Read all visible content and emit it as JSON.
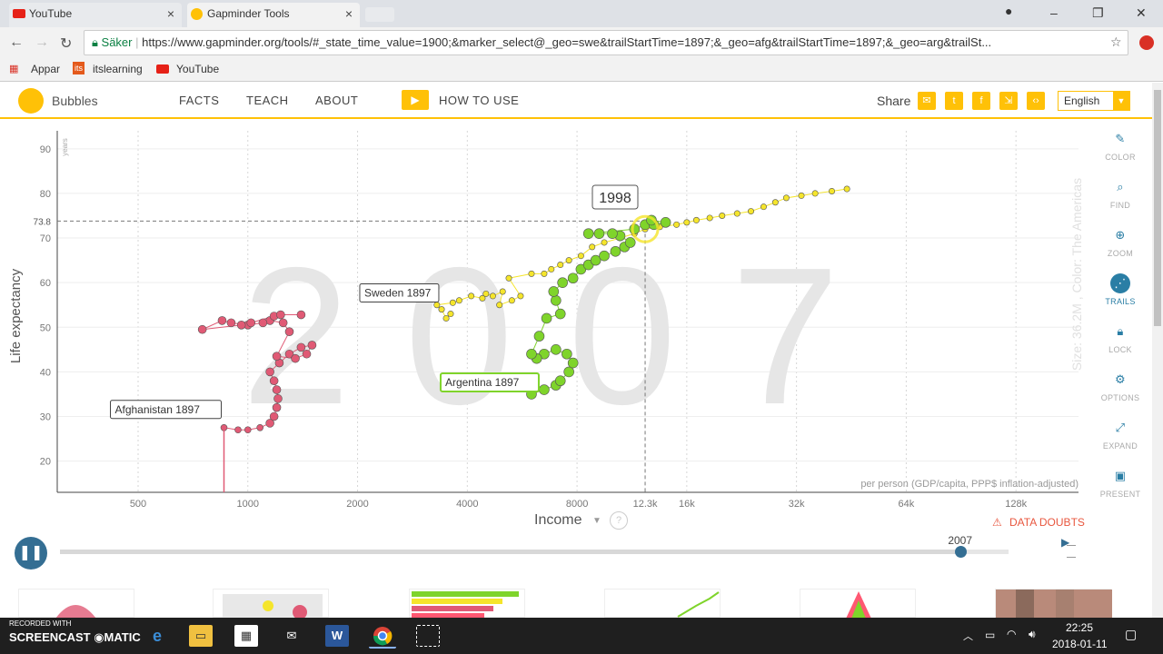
{
  "browser": {
    "tabs": [
      {
        "label": "YouTube",
        "close": "×"
      },
      {
        "label": "Gapminder Tools",
        "close": "×"
      }
    ],
    "security_label": "Säker",
    "url": "https://www.gapminder.org/tools/#_state_time_value=1900;&marker_select@_geo=swe&trailStartTime=1897;&_geo=afg&trailStartTime=1897;&_geo=arg&trailSt...",
    "bookmarks": [
      "Appar",
      "itslearning",
      "YouTube"
    ],
    "bookmark_badge": "its"
  },
  "header": {
    "app_name": "Bubbles",
    "nav": [
      "FACTS",
      "TEACH",
      "ABOUT"
    ],
    "how_to_use": "HOW TO USE",
    "share_label": "Share",
    "language": "English"
  },
  "chart_data": {
    "type": "scatter",
    "x_scale": "log",
    "xlim": [
      300,
      190000
    ],
    "ylim": [
      13,
      92
    ],
    "yticks": [
      20,
      30,
      40,
      50,
      60,
      70,
      80,
      90
    ],
    "xticks": [
      {
        "v": 500,
        "label": "500"
      },
      {
        "v": 1000,
        "label": "1000"
      },
      {
        "v": 2000,
        "label": "2000"
      },
      {
        "v": 4000,
        "label": "4000"
      },
      {
        "v": 8000,
        "label": "8000"
      },
      {
        "v": 12300,
        "label": "12.3k"
      },
      {
        "v": 16000,
        "label": "16k"
      },
      {
        "v": 32000,
        "label": "32k"
      },
      {
        "v": 64000,
        "label": "64k"
      },
      {
        "v": 128000,
        "label": "128k"
      }
    ],
    "ylabel": "Life expectancy",
    "yunit": "years",
    "xlabel": "Income",
    "xsub": "per person (GDP/capita, PPP$ inflation-adjusted)",
    "size_label": "Size: 36.2M , Color: The Americas",
    "year_watermark": "2007",
    "highlight_year": "1998",
    "highlight_y": 73.8,
    "highlight_y_label": "73.8",
    "hover_x": 12300,
    "series": [
      {
        "name": "Afghanistan 1897",
        "color": "#e05a75",
        "points": [
          [
            860,
            27.5
          ],
          [
            940,
            27
          ],
          [
            1000,
            27
          ],
          [
            1080,
            27.5
          ],
          [
            1150,
            28.5
          ],
          [
            1180,
            30
          ],
          [
            1200,
            32
          ],
          [
            1210,
            34
          ],
          [
            1200,
            36
          ],
          [
            1180,
            38
          ],
          [
            1150,
            40
          ],
          [
            1220,
            42
          ],
          [
            1300,
            44
          ],
          [
            1400,
            45.5
          ],
          [
            1500,
            46
          ],
          [
            1450,
            44
          ],
          [
            1350,
            43
          ],
          [
            1200,
            43.5
          ],
          [
            1300,
            49
          ],
          [
            1250,
            51
          ],
          [
            1150,
            51.5
          ],
          [
            1100,
            51
          ],
          [
            1000,
            50.5
          ],
          [
            900,
            51
          ],
          [
            850,
            51.5
          ],
          [
            750,
            49.5
          ],
          [
            960,
            50.5
          ],
          [
            1020,
            51
          ],
          [
            1180,
            52.5
          ],
          [
            1230,
            52.8
          ],
          [
            1400,
            52.8
          ]
        ]
      },
      {
        "name": "Sweden 1897",
        "color": "#f5e52b",
        "points": [
          [
            3600,
            53
          ],
          [
            3500,
            52
          ],
          [
            3400,
            54
          ],
          [
            3300,
            55
          ],
          [
            3650,
            55.5
          ],
          [
            3800,
            56
          ],
          [
            4100,
            57
          ],
          [
            4400,
            56.5
          ],
          [
            4500,
            57.5
          ],
          [
            4700,
            57
          ],
          [
            5000,
            58
          ],
          [
            4900,
            55
          ],
          [
            5300,
            56
          ],
          [
            5600,
            57
          ],
          [
            5200,
            61
          ],
          [
            6000,
            62
          ],
          [
            6500,
            62
          ],
          [
            6800,
            63
          ],
          [
            7200,
            64
          ],
          [
            7600,
            65
          ],
          [
            8200,
            66
          ],
          [
            8800,
            68
          ],
          [
            9500,
            69
          ],
          [
            10500,
            70
          ],
          [
            11500,
            71
          ],
          [
            12300,
            72
          ],
          [
            13500,
            72.5
          ],
          [
            15000,
            73
          ],
          [
            16000,
            73.5
          ],
          [
            17000,
            74
          ],
          [
            18500,
            74.5
          ],
          [
            20000,
            75
          ],
          [
            22000,
            75.5
          ],
          [
            24000,
            76
          ],
          [
            26000,
            77
          ],
          [
            28000,
            78
          ],
          [
            30000,
            79
          ],
          [
            33000,
            79.5
          ],
          [
            36000,
            80
          ],
          [
            40000,
            80.5
          ],
          [
            44000,
            81
          ]
        ]
      },
      {
        "name": "Argentina 1897",
        "color": "#7fd42b",
        "points": [
          [
            6000,
            35
          ],
          [
            6500,
            36
          ],
          [
            7000,
            37
          ],
          [
            7200,
            38
          ],
          [
            7600,
            40
          ],
          [
            7800,
            42
          ],
          [
            7500,
            44
          ],
          [
            7000,
            45
          ],
          [
            6500,
            44
          ],
          [
            6200,
            43
          ],
          [
            6000,
            44
          ],
          [
            6300,
            48
          ],
          [
            6600,
            52
          ],
          [
            7200,
            53
          ],
          [
            7000,
            56
          ],
          [
            6900,
            58
          ],
          [
            7300,
            60
          ],
          [
            7800,
            61
          ],
          [
            8200,
            63
          ],
          [
            8600,
            64
          ],
          [
            9000,
            65
          ],
          [
            9500,
            66
          ],
          [
            10200,
            67
          ],
          [
            10800,
            68
          ],
          [
            11200,
            69
          ],
          [
            10500,
            70.5
          ],
          [
            10000,
            71
          ],
          [
            9200,
            71
          ],
          [
            8600,
            71
          ],
          [
            11500,
            72
          ],
          [
            12300,
            73
          ],
          [
            13000,
            73
          ],
          [
            14000,
            73.5
          ],
          [
            12800,
            74
          ]
        ]
      }
    ]
  },
  "side_controls": [
    "COLOR",
    "FIND",
    "ZOOM",
    "TRAILS",
    "LOCK",
    "OPTIONS",
    "EXPAND",
    "PRESENT"
  ],
  "footer": {
    "data_doubts": "DATA DOUBTS",
    "current_year": "2007"
  },
  "taskbar": {
    "recorder_line1": "RECORDED WITH",
    "recorder_line2": "SCREENCAST",
    "recorder_line3": "MATIC",
    "time": "22:25",
    "date": "2018-01-11"
  }
}
